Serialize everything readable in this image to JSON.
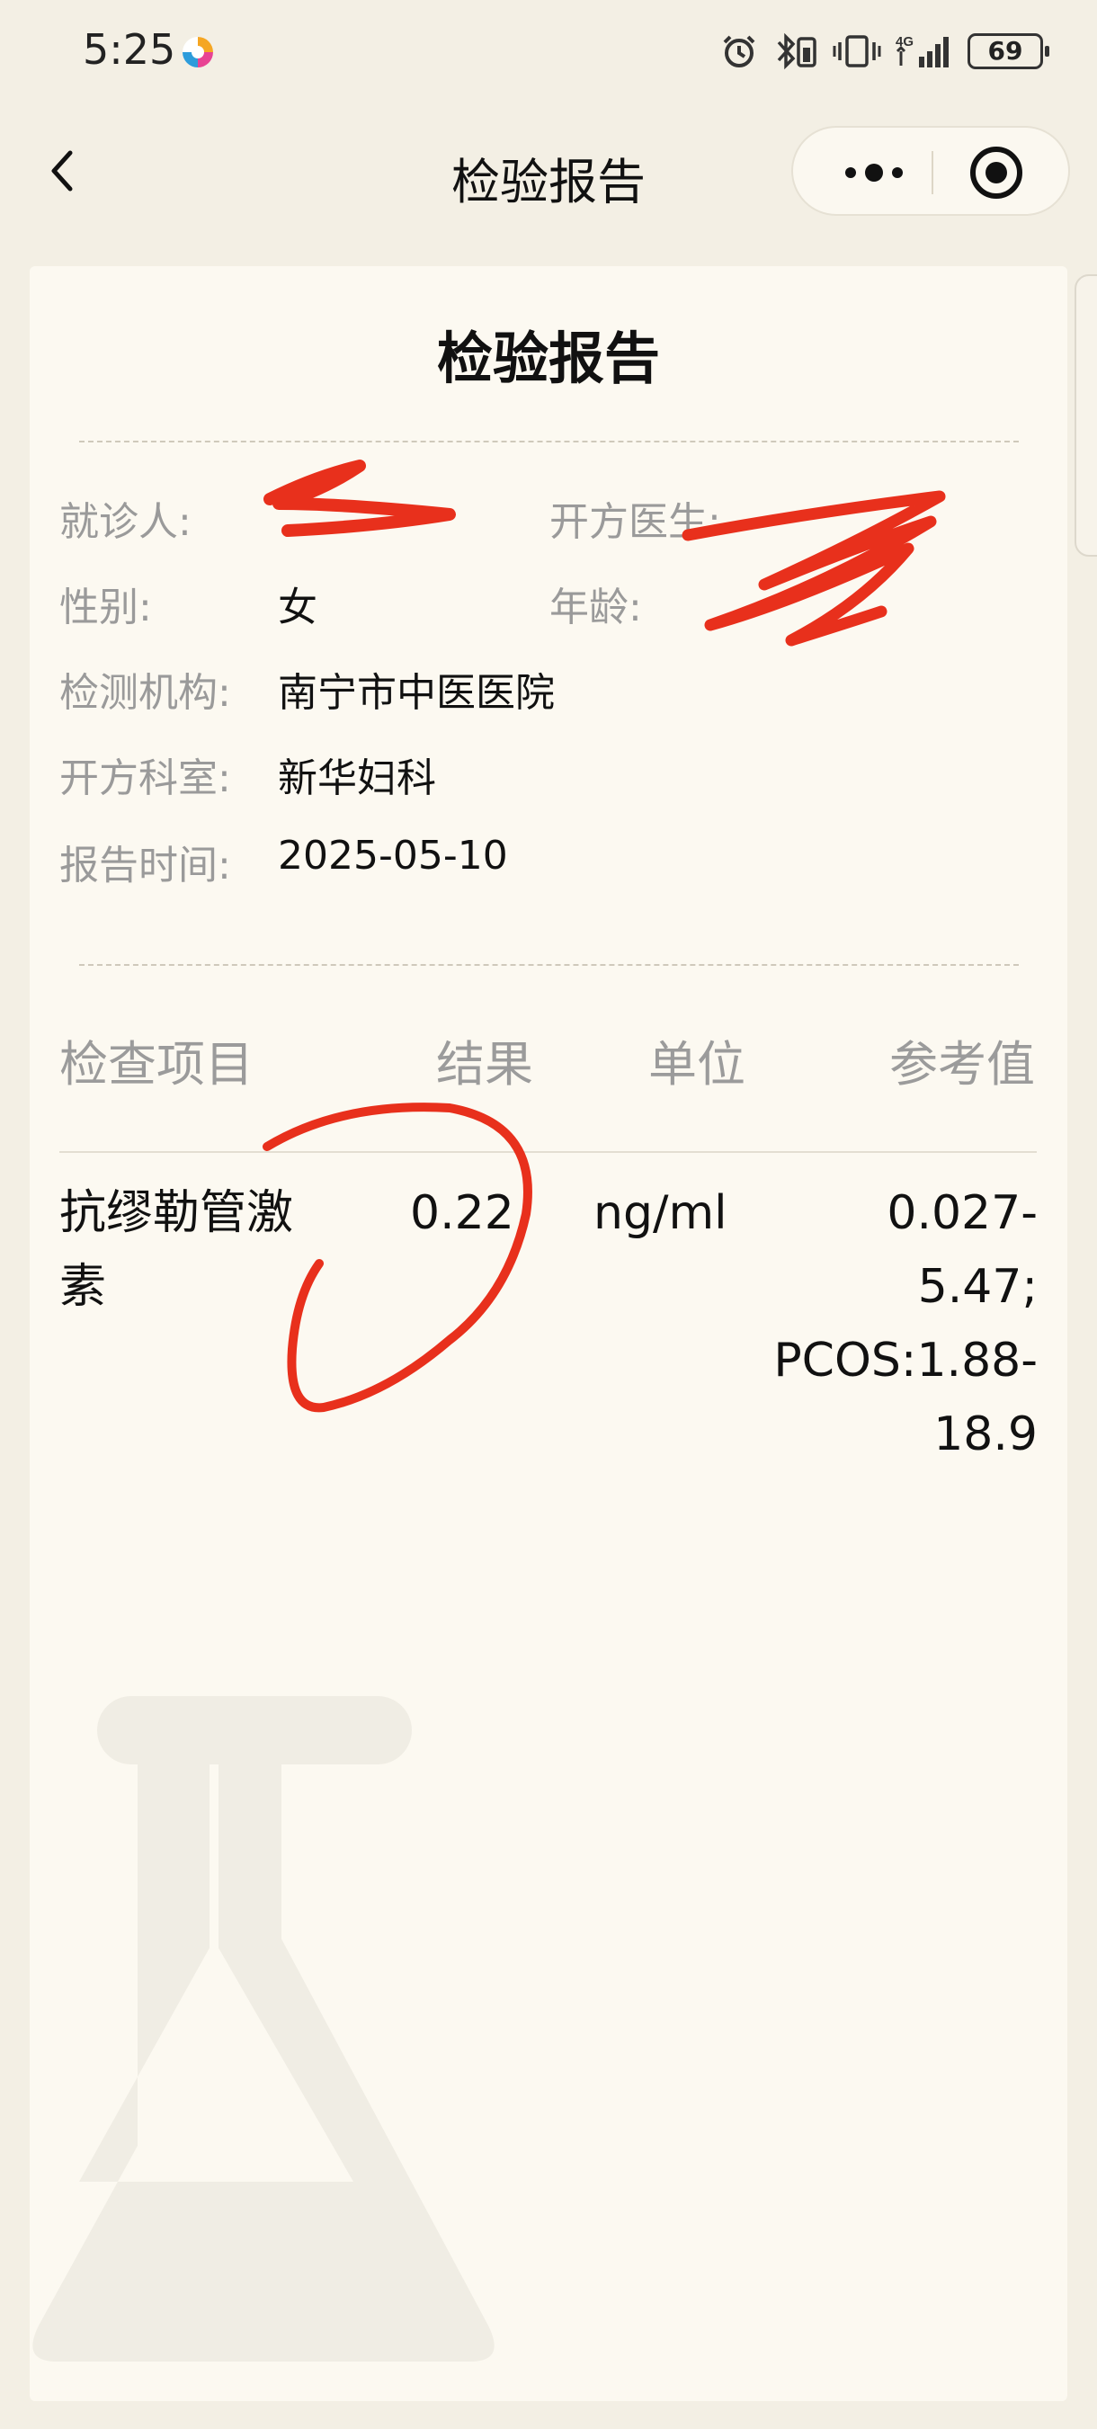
{
  "status_bar": {
    "time": "5:25",
    "battery": "69"
  },
  "nav": {
    "title": "检验报告"
  },
  "report": {
    "title": "检验报告",
    "patient_label": "就诊人:",
    "doctor_label": "开方医生:",
    "gender_label": "性别:",
    "gender_value": "女",
    "age_label": "年龄:",
    "institution_label": "检测机构:",
    "institution_value": "南宁市中医医院",
    "department_label": "开方科室:",
    "department_value": "新华妇科",
    "report_time_label": "报告时间:",
    "report_time_value": "2025-05-10"
  },
  "table": {
    "headers": {
      "item": "检查项目",
      "result": "结果",
      "unit": "单位",
      "reference": "参考值"
    },
    "rows": [
      {
        "item_line1": "抗缪勒管激",
        "item_line2": "素",
        "result": "0.22",
        "unit": "ng/ml",
        "ref_line1": "0.027-",
        "ref_line2": "5.47;",
        "ref_line3": "PCOS:1.88-",
        "ref_line4": "18.9"
      }
    ]
  },
  "colors": {
    "page_bg": "#f3efe4",
    "card_bg": "#fcf9f1",
    "annotation_red": "#e8301c"
  },
  "icons": [
    "back-icon",
    "more-icon",
    "close-target-icon",
    "flask-watermark-icon",
    "alarm-icon",
    "bluetooth-icon",
    "vibrate-icon",
    "signal-icon",
    "battery-icon"
  ]
}
